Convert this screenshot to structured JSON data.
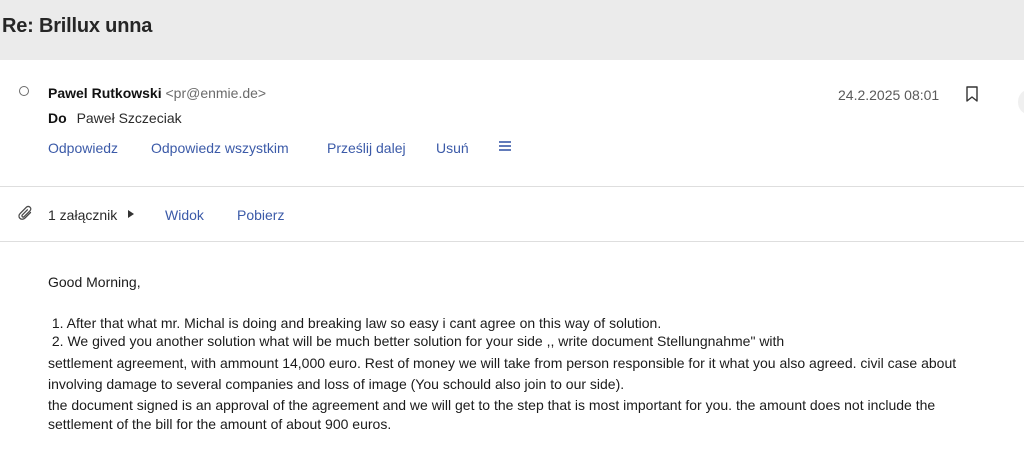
{
  "subject": "Re: Brillux unna",
  "sender": {
    "name": "Pawel Rutkowski",
    "email": "<pr@enmie.de>"
  },
  "date": "24.2.2025 08:01",
  "to": {
    "label": "Do",
    "name": "Paweł Szczeciak"
  },
  "actions": {
    "reply": "Odpowiedz",
    "reply_all": "Odpowiedz wszystkim",
    "forward": "Prześlij dalej",
    "delete": "Usuń"
  },
  "attachments": {
    "count_label": "1 załącznik",
    "view": "Widok",
    "download": "Pobierz"
  },
  "body": {
    "greeting": "Good Morning,",
    "item1": " 1. After that what mr. Michal is doing and breaking law so easy i cant agree on this way of solution.",
    "item2": " 2. We gived you another solution what will be much better solution for your side ,, write document Stellungnahme\" with",
    "line3": "settlement agreement, with ammount 14,000 euro. Rest of money we will take from person responsible for it what you also agreed. civil case about",
    "line4": "involving damage to several companies and loss of image (You schould also join to our side).",
    "line5": "the document signed is an approval of the agreement and we will get to the step that is most important for you. the amount does not include the",
    "line6": "settlement of the bill for the amount of about 900 euros."
  }
}
